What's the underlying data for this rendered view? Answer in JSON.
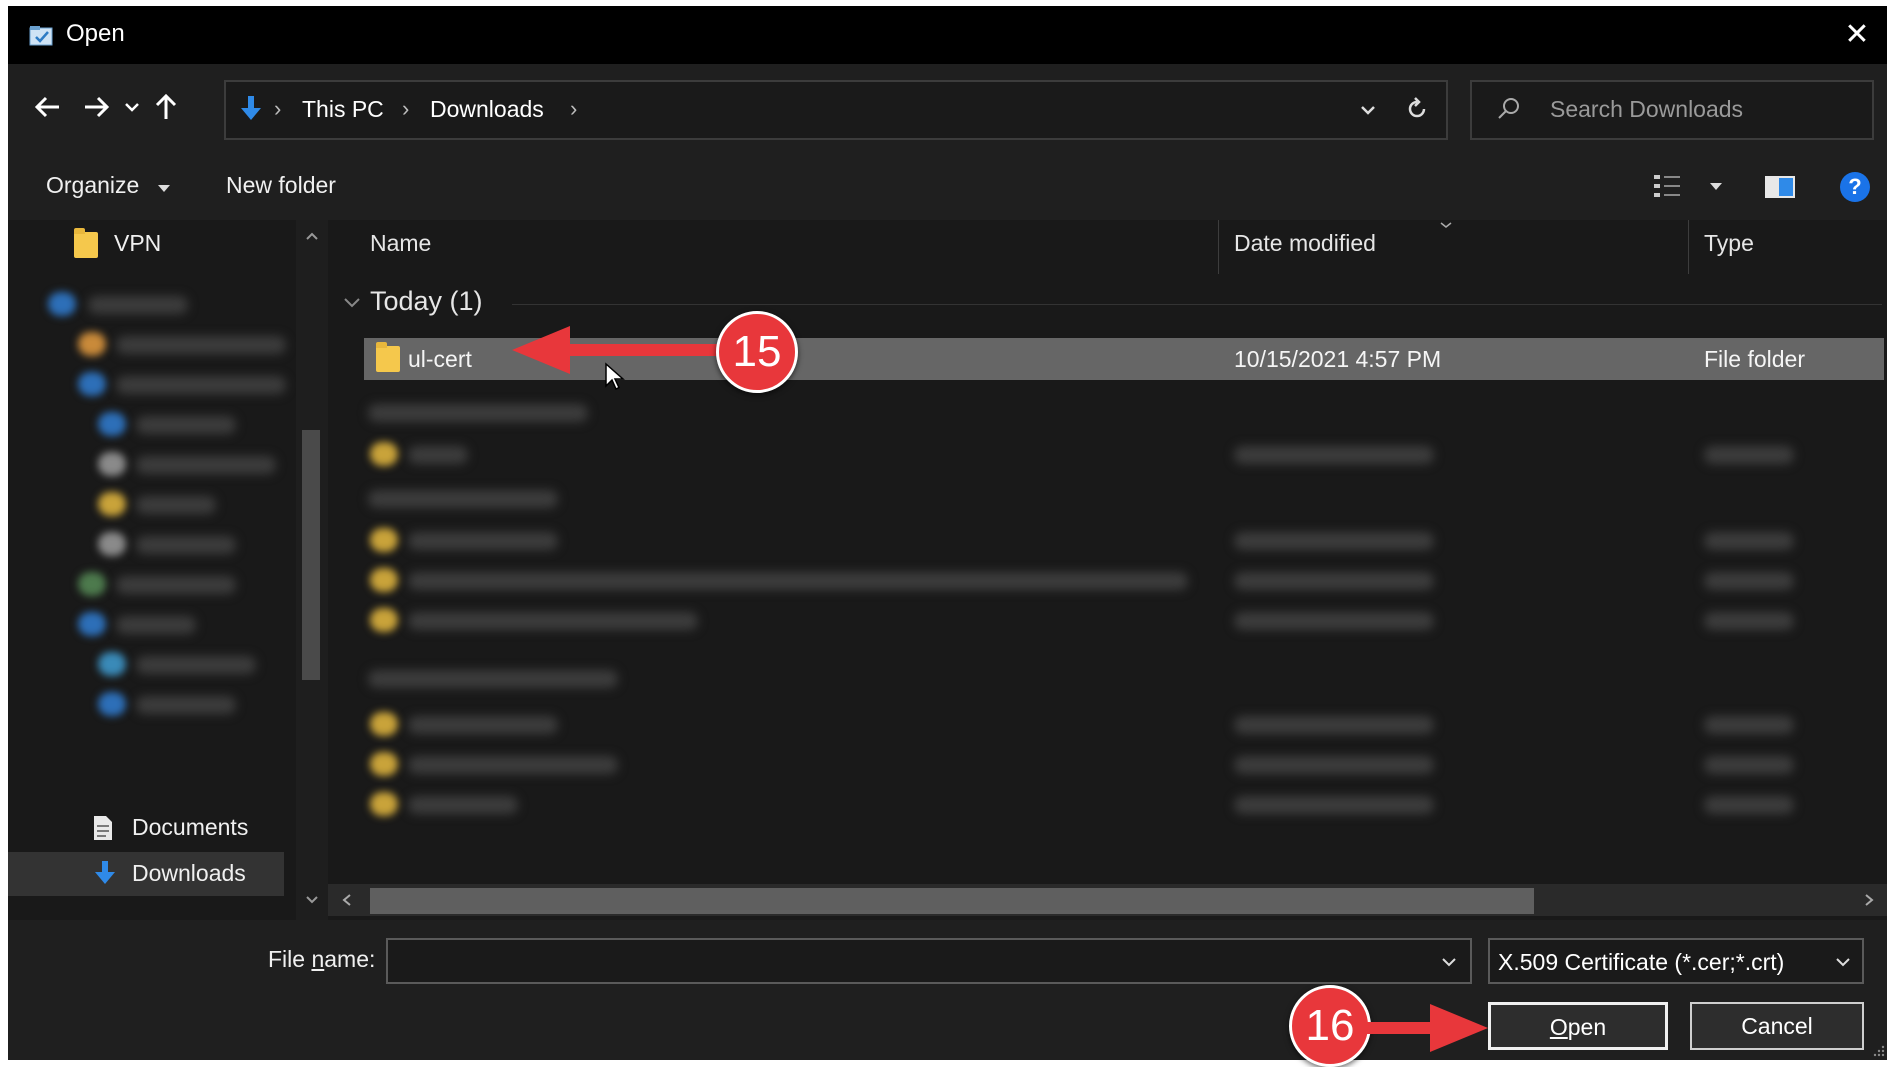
{
  "window": {
    "title": "Open",
    "close_glyph": "✕"
  },
  "nav": {
    "back_icon": "arrow-left-icon",
    "forward_icon": "arrow-right-icon",
    "recent_icon": "chevron-down-icon",
    "up_icon": "arrow-up-icon",
    "breadcrumbs": [
      "This PC",
      "Downloads"
    ],
    "search_placeholder": "Search Downloads"
  },
  "toolbar": {
    "organize_label": "Organize",
    "new_folder_label": "New folder",
    "help_glyph": "?"
  },
  "sidebar": {
    "top_item": "VPN",
    "documents": "Documents",
    "downloads": "Downloads"
  },
  "columns": {
    "name": "Name",
    "date_modified": "Date modified",
    "type": "Type"
  },
  "groups": {
    "today": {
      "label": "Today (1)",
      "rows": [
        {
          "name": "ul-cert",
          "date_modified": "10/15/2021 4:57 PM",
          "type": "File folder"
        }
      ]
    }
  },
  "bottom": {
    "file_name_label_prefix": "File ",
    "file_name_label_underlined": "n",
    "file_name_label_suffix": "ame:",
    "file_name_value": "",
    "filter_value": "X.509 Certificate (*.cer;*.crt)",
    "open_underlined": "O",
    "open_rest": "pen",
    "cancel_label": "Cancel"
  },
  "annotations": {
    "step_15": "15",
    "step_16": "16"
  },
  "colors": {
    "annotation_red": "#e8373b",
    "selection": "#666666",
    "folder": "#f5c84c",
    "help": "#1a73e8"
  }
}
